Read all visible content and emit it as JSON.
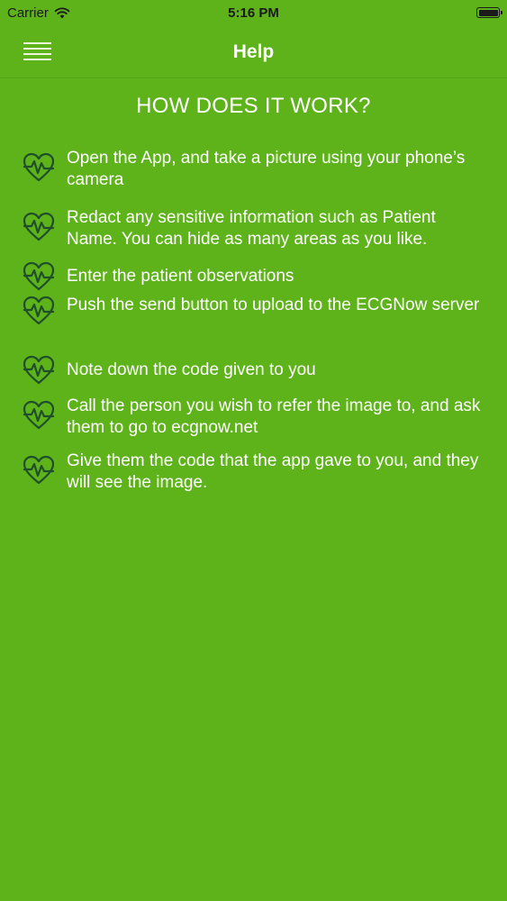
{
  "status_bar": {
    "carrier": "Carrier",
    "time": "5:16 PM",
    "wifi_icon": "wifi-icon",
    "battery_icon": "battery-icon"
  },
  "nav": {
    "title": "Help",
    "menu_icon": "hamburger-menu-icon"
  },
  "main": {
    "heading": "HOW DOES IT WORK?",
    "step_icon": "heart-pulse-icon",
    "steps": [
      {
        "text": "Open the App, and take a picture using your phone’s camera"
      },
      {
        "text": "Redact any sensitive information such as Patient Name. You can hide as many areas as you like."
      },
      {
        "text": "Enter the patient observations"
      },
      {
        "text": "Push the send button to upload to the ECGNow server"
      },
      {
        "text": "Note down the code given to you"
      },
      {
        "text": "Call the person you wish to refer the image to, and ask them to go to ecgnow.net"
      },
      {
        "text": "Give them the code that the app gave to you, and they will see the image."
      }
    ]
  },
  "colors": {
    "background": "#5eb21a",
    "icon_stroke": "#1f4f2a",
    "text": "#ffffff"
  }
}
